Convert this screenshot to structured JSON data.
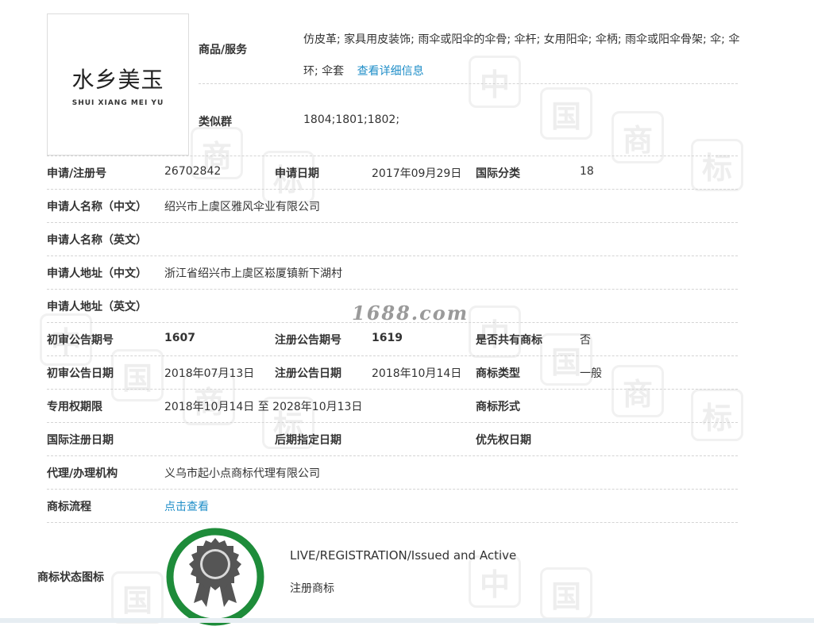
{
  "logo": {
    "chinese_text": "水乡美玉",
    "english_text": "SHUI XIANG MEI YU"
  },
  "watermark": {
    "site": "1688.com",
    "glyphs": [
      "中",
      "国",
      "商",
      "标"
    ]
  },
  "goods_services": {
    "label": "商品/服务",
    "text": "仿皮革; 家具用皮装饰; 雨伞或阳伞的伞骨; 伞杆; 女用阳伞; 伞柄; 雨伞或阳伞骨架; 伞; 伞环; 伞套",
    "detail_link": "查看详细信息"
  },
  "similar_group": {
    "label": "类似群",
    "value": "1804;1801;1802;"
  },
  "fields": {
    "app_no_label": "申请/注册号",
    "app_no": "26702842",
    "app_date_label": "申请日期",
    "app_date": "2017年09月29日",
    "intl_class_label": "国际分类",
    "intl_class": "18",
    "applicant_cn_label": "申请人名称（中文）",
    "applicant_cn": "绍兴市上虞区雅风伞业有限公司",
    "applicant_en_label": "申请人名称（英文）",
    "applicant_en": "",
    "address_cn_label": "申请人地址（中文）",
    "address_cn": "浙江省绍兴市上虞区崧厦镇新下湖村",
    "address_en_label": "申请人地址（英文）",
    "address_en": "",
    "prelim_issue_label": "初审公告期号",
    "prelim_issue": "1607",
    "reg_issue_label": "注册公告期号",
    "reg_issue": "1619",
    "shared_label": "是否共有商标",
    "shared": "否",
    "prelim_date_label": "初审公告日期",
    "prelim_date": "2018年07月13日",
    "reg_date_label": "注册公告日期",
    "reg_date": "2018年10月14日",
    "tm_type_label": "商标类型",
    "tm_type": "一般",
    "exclusive_label": "专用权期限",
    "exclusive": "2018年10月14日 至 2028年10月13日",
    "tm_form_label": "商标形式",
    "tm_form": "",
    "intl_reg_date_label": "国际注册日期",
    "intl_reg_date": "",
    "later_date_label": "后期指定日期",
    "later_date": "",
    "priority_date_label": "优先权日期",
    "priority_date": "",
    "agency_label": "代理/办理机构",
    "agency": "义乌市起小点商标代理有限公司",
    "process_label": "商标流程",
    "process_link": "点击查看",
    "status_icon_label": "商标状态图标"
  },
  "status": {
    "english": "LIVE/REGISTRATION/Issued and Active",
    "chinese": "注册商标",
    "ring_color": "#1e8c3a",
    "medal_color": "#555555"
  }
}
